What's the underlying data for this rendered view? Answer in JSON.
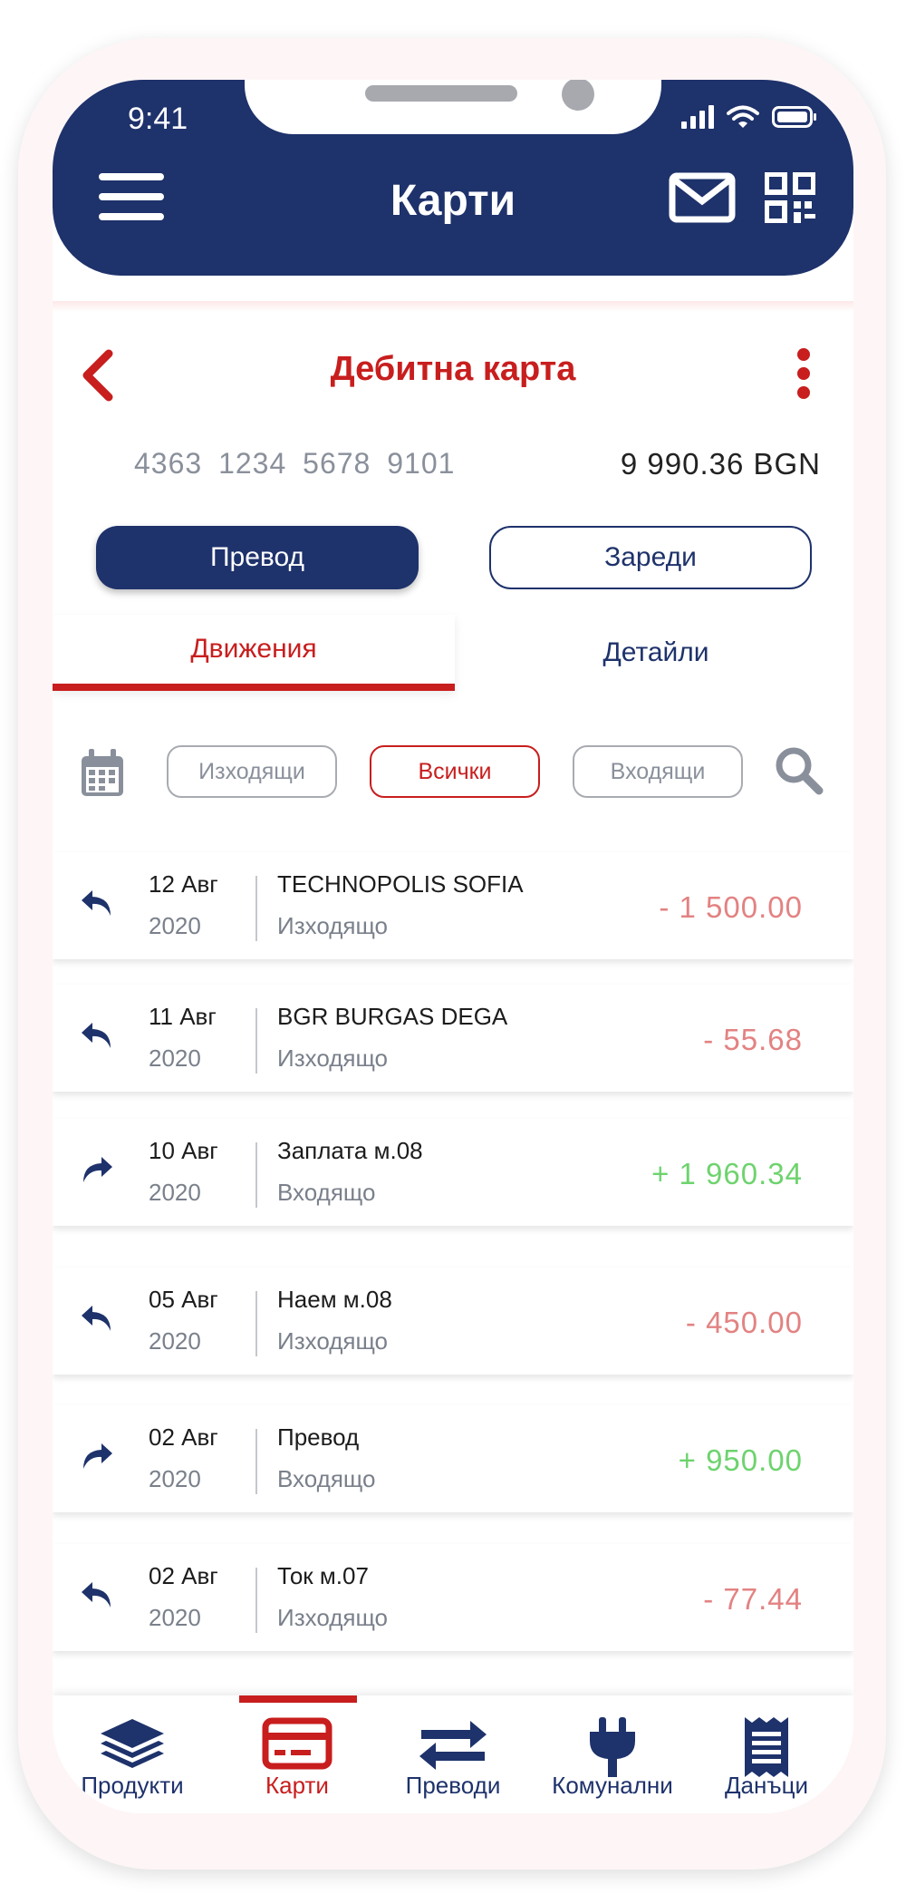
{
  "status_bar": {
    "time": "9:41"
  },
  "header": {
    "title": "Карти"
  },
  "card": {
    "title": "Дебитна карта",
    "number": "4363 1234 5678 9101",
    "balance": "9 990.36 BGN",
    "primary_button": "Превод",
    "secondary_button": "Зареди"
  },
  "tabs": [
    {
      "label": "Движения",
      "active": true
    },
    {
      "label": "Детайли",
      "active": false
    }
  ],
  "filters": {
    "outgoing": "Изходящи",
    "all": "Всички",
    "incoming": "Входящи",
    "selected": "Всички"
  },
  "transactions": [
    {
      "day": "12 Авг",
      "year": "2020",
      "name": "TECHNOPOLIS SOFIA",
      "type": "Изходящо",
      "amount": "- 1 500.00",
      "direction": "out"
    },
    {
      "day": "11 Авг",
      "year": "2020",
      "name": "BGR BURGAS DEGA",
      "type": "Изходящо",
      "amount": "- 55.68",
      "direction": "out"
    },
    {
      "day": "10 Авг",
      "year": "2020",
      "name": "Заплата м.08",
      "type": "Входящо",
      "amount": "+ 1 960.34",
      "direction": "in"
    },
    {
      "day": "05 Авг",
      "year": "2020",
      "name": "Наем м.08",
      "type": "Изходящо",
      "amount": "- 450.00",
      "direction": "out"
    },
    {
      "day": "02 Авг",
      "year": "2020",
      "name": "Превод",
      "type": "Входящо",
      "amount": "+ 950.00",
      "direction": "in"
    },
    {
      "day": "02 Авг",
      "year": "2020",
      "name": "Ток м.07",
      "type": "Изходящо",
      "amount": "- 77.44",
      "direction": "out"
    }
  ],
  "bottom_nav": [
    {
      "label": "Продукти",
      "icon": "layers-icon"
    },
    {
      "label": "Карти",
      "icon": "card-icon",
      "active": true
    },
    {
      "label": "Преводи",
      "icon": "transfer-icon"
    },
    {
      "label": "Комунални",
      "icon": "plug-icon"
    },
    {
      "label": "Данъци",
      "icon": "receipt-icon"
    }
  ],
  "colors": {
    "brand_navy": "#1e326b",
    "accent_red": "#c81e1e",
    "negative_amount": "#e38282",
    "positive_amount": "#6ed36e"
  }
}
